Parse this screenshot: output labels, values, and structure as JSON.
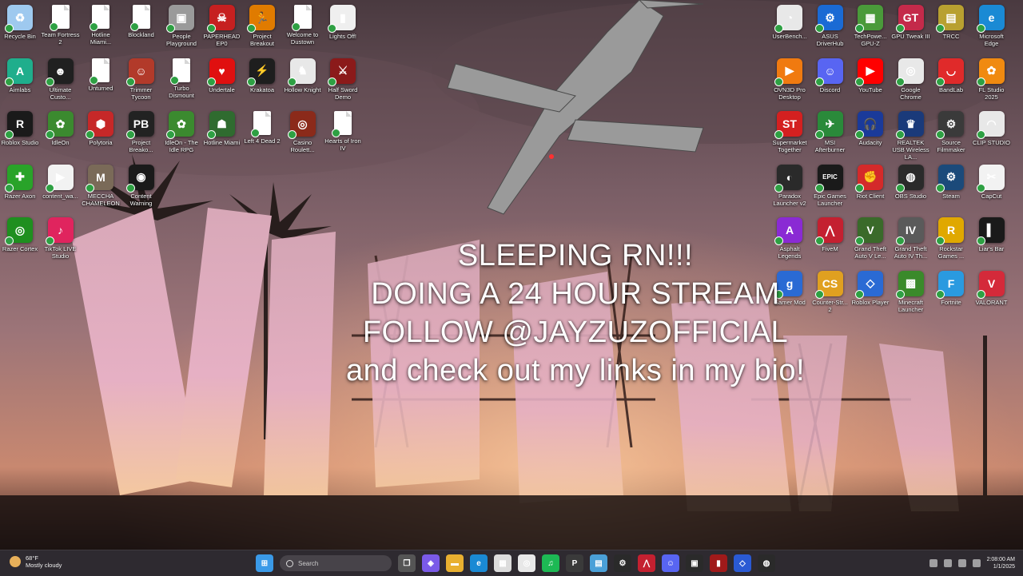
{
  "desktop": {
    "left_columns": [
      [
        {
          "label": "Recycle Bin",
          "icon": "recycle-bin-icon",
          "color": "#9ec9ef",
          "glyph": "♻"
        },
        {
          "label": "Aimlabs",
          "icon": "aimlabs-icon",
          "color": "#1fae8c",
          "glyph": "A"
        },
        {
          "label": "Roblox Studio",
          "icon": "roblox-studio-icon",
          "color": "#1a1a1a",
          "glyph": "R"
        },
        {
          "label": "Razer Axon",
          "icon": "razer-axon-icon",
          "color": "#29a329",
          "glyph": "✚"
        },
        {
          "label": "Razer Cortex",
          "icon": "razer-cortex-icon",
          "color": "#1f8f1f",
          "glyph": "◎"
        }
      ],
      [
        {
          "label": "Team Fortress 2",
          "icon": "document-icon",
          "doc": true
        },
        {
          "label": "Ultimate Custo...",
          "icon": "ultimate-custom-night-icon",
          "color": "#202020",
          "glyph": "☻"
        },
        {
          "label": "IdleOn",
          "icon": "idleon-icon",
          "color": "#3b8a2f",
          "glyph": "✿"
        },
        {
          "label": "content_wa...",
          "icon": "video-file-icon",
          "color": "#f2f2f2",
          "glyph": "▶"
        },
        {
          "label": "TikTok LIVE Studio",
          "icon": "tiktok-live-icon",
          "color": "#e0245e",
          "glyph": "♪"
        }
      ],
      [
        {
          "label": "Hotline Miami...",
          "icon": "document-icon",
          "doc": true
        },
        {
          "label": "Unturned",
          "icon": "document-icon",
          "doc": true
        },
        {
          "label": "Polytoria",
          "icon": "polytoria-icon",
          "color": "#c62828",
          "glyph": "⬢"
        },
        {
          "label": "MECCHA CHAMELEON",
          "icon": "meccha-chameleon-icon",
          "color": "#7a6a58",
          "glyph": "M"
        }
      ],
      [
        {
          "label": "Blockland",
          "icon": "document-icon",
          "doc": true
        },
        {
          "label": "Trimmer Tycoon",
          "icon": "trimmer-tycoon-icon",
          "color": "#b23a2a",
          "glyph": "☺"
        },
        {
          "label": "Project Breako...",
          "icon": "project-breakout-pb-icon",
          "color": "#222",
          "glyph": "PB"
        },
        {
          "label": "Content Warning",
          "icon": "content-warning-icon",
          "color": "#1a1a1a",
          "glyph": "◉"
        }
      ],
      [
        {
          "label": "People Playground",
          "icon": "people-playground-icon",
          "color": "#9a9a9a",
          "glyph": "▣"
        },
        {
          "label": "Turbo Dismount",
          "icon": "document-icon",
          "doc": true
        },
        {
          "label": "IdleOn - The Idle RPG",
          "icon": "idleon-rpg-icon",
          "color": "#3b8a2f",
          "glyph": "✿"
        }
      ],
      [
        {
          "label": "PAPERHEAD EP0",
          "icon": "paperhead-icon",
          "color": "#c62020",
          "glyph": "☠"
        },
        {
          "label": "Undertale",
          "icon": "undertale-icon",
          "color": "#e01010",
          "glyph": "♥"
        },
        {
          "label": "Hotline Miami",
          "icon": "hotline-miami-icon",
          "color": "#2f6b2f",
          "glyph": "☗"
        }
      ],
      [
        {
          "label": "Project Breakout",
          "icon": "project-breakout-icon",
          "color": "#e07b00",
          "glyph": "🏃"
        },
        {
          "label": "Krakatoa",
          "icon": "krakatoa-icon",
          "color": "#1e1e1e",
          "glyph": "⚡"
        },
        {
          "label": "Left 4 Dead 2",
          "icon": "document-icon",
          "doc": true
        }
      ],
      [
        {
          "label": "Welcome to Dustown",
          "icon": "document-icon",
          "doc": true
        },
        {
          "label": "Hollow Knight",
          "icon": "hollow-knight-icon",
          "color": "#e8e8e8",
          "glyph": "♞"
        },
        {
          "label": "Casino Roulett...",
          "icon": "casino-roulette-icon",
          "color": "#8b2a1a",
          "glyph": "◎"
        }
      ],
      [
        {
          "label": "Lights Off!",
          "icon": "lights-off-icon",
          "color": "#efefef",
          "glyph": "▮"
        },
        {
          "label": "Half Sword Demo",
          "icon": "half-sword-icon",
          "color": "#8b1a1a",
          "glyph": "⚔"
        },
        {
          "label": "Hearts of Iron IV",
          "icon": "document-icon",
          "doc": true
        }
      ]
    ],
    "right_columns": [
      [
        {
          "label": "UserBench...",
          "icon": "userbenchmark-icon",
          "color": "#e8e8e8",
          "glyph": "◔"
        },
        {
          "label": "OVN3D Pro Desktop",
          "icon": "ovn3d-icon",
          "color": "#f07a10",
          "glyph": "▶"
        },
        {
          "label": "Supermarket Together",
          "icon": "supermarket-together-icon",
          "color": "#d42020",
          "glyph": "ST"
        },
        {
          "label": "Paradox Launcher v2",
          "icon": "paradox-launcher-icon",
          "color": "#2a2a2a",
          "glyph": "◐"
        },
        {
          "label": "Asphalt Legends",
          "icon": "asphalt-legends-icon",
          "color": "#8a2ad4",
          "glyph": "A"
        },
        {
          "label": "Gamer Mod",
          "icon": "gamer-mod-icon",
          "color": "#2a6ad4",
          "glyph": "g"
        }
      ],
      [
        {
          "label": "ASUS DriverHub",
          "icon": "asus-driverhub-icon",
          "color": "#1a6ad4",
          "glyph": "⚙"
        },
        {
          "label": "Discord",
          "icon": "discord-icon",
          "color": "#5865f2",
          "glyph": "☺"
        },
        {
          "label": "MSI Afterburner",
          "icon": "msi-afterburner-icon",
          "color": "#2a8a3a",
          "glyph": "✈"
        },
        {
          "label": "Epic Games Launcher",
          "icon": "epic-games-icon",
          "color": "#1a1a1a",
          "glyph": "EPIC"
        },
        {
          "label": "FiveM",
          "icon": "fivem-icon",
          "color": "#c42030",
          "glyph": "⋀"
        },
        {
          "label": "Counter-Str... 2",
          "icon": "counter-strike-icon",
          "color": "#e0a020",
          "glyph": "CS"
        }
      ],
      [
        {
          "label": "TechPowe... GPU-Z",
          "icon": "gpu-z-icon",
          "color": "#4a9a3a",
          "glyph": "▦"
        },
        {
          "label": "YouTube",
          "icon": "youtube-icon",
          "color": "#ff0000",
          "glyph": "▶"
        },
        {
          "label": "Audacity",
          "icon": "audacity-icon",
          "color": "#1a3a9a",
          "glyph": "🎧"
        },
        {
          "label": "Riot Client",
          "icon": "riot-client-icon",
          "color": "#d42a2a",
          "glyph": "✊"
        },
        {
          "label": "Grand Theft Auto V Le...",
          "icon": "gta-v-icon",
          "color": "#3a6a2a",
          "glyph": "V"
        },
        {
          "label": "Roblox Player",
          "icon": "roblox-player-icon",
          "color": "#2a6ad4",
          "glyph": "◇"
        }
      ],
      [
        {
          "label": "GPU Tweak III",
          "icon": "gpu-tweak-icon",
          "color": "#c42a4a",
          "glyph": "GT"
        },
        {
          "label": "Google Chrome",
          "icon": "google-chrome-icon",
          "color": "#e8e8e8",
          "glyph": "◎"
        },
        {
          "label": "REALTEK USB Wireless LA...",
          "icon": "realtek-icon",
          "color": "#1a3a7a",
          "glyph": "♛"
        },
        {
          "label": "OBS Studio",
          "icon": "obs-studio-icon",
          "color": "#2a2a2a",
          "glyph": "◍"
        },
        {
          "label": "Grand Theft Auto IV Th...",
          "icon": "gta-iv-icon",
          "color": "#5a5a5a",
          "glyph": "IV"
        },
        {
          "label": "Minecraft Launcher",
          "icon": "minecraft-launcher-icon",
          "color": "#3a8a2a",
          "glyph": "▩"
        }
      ],
      [
        {
          "label": "TRCC",
          "icon": "trcc-icon",
          "color": "#b8a030",
          "glyph": "▤"
        },
        {
          "label": "BandLab",
          "icon": "bandlab-icon",
          "color": "#e02a2a",
          "glyph": "◡"
        },
        {
          "label": "Source Filmmaker",
          "icon": "source-filmmaker-icon",
          "color": "#3a3a3a",
          "glyph": "⚙"
        },
        {
          "label": "Steam",
          "icon": "steam-icon",
          "color": "#1b4a7a",
          "glyph": "⚙"
        },
        {
          "label": "Rockstar Games ...",
          "icon": "rockstar-games-icon",
          "color": "#e0a800",
          "glyph": "R"
        },
        {
          "label": "Fortnite",
          "icon": "fortnite-icon",
          "color": "#2a9ae0",
          "glyph": "F"
        }
      ],
      [
        {
          "label": "Microsoft Edge",
          "icon": "microsoft-edge-icon",
          "color": "#1a8ad4",
          "glyph": "e"
        },
        {
          "label": "FL Studio 2025",
          "icon": "fl-studio-icon",
          "color": "#f08a10",
          "glyph": "✿"
        },
        {
          "label": "CLIP STUDIO",
          "icon": "clip-studio-icon",
          "color": "#e8e8e8",
          "glyph": "◠"
        },
        {
          "label": "CapCut",
          "icon": "capcut-icon",
          "color": "#f2f2f2",
          "glyph": "✂"
        },
        {
          "label": "Liar's Bar",
          "icon": "liars-bar-icon",
          "color": "#1a1a1a",
          "glyph": "▍"
        },
        {
          "label": "VALORANT",
          "icon": "valorant-icon",
          "color": "#d42a3a",
          "glyph": "V"
        }
      ]
    ]
  },
  "overlay": {
    "line1": "SLEEPING RN!!!",
    "line2": "DOING A 24 HOUR STREAM",
    "line3": "FOLLOW @JAYZUZOFFICIAL",
    "line4": "and check out my links in my bio!"
  },
  "taskbar": {
    "weather_temp": "68°F",
    "weather_desc": "Mostly cloudy",
    "search_placeholder": "Search",
    "apps": [
      {
        "name": "start-button",
        "color": "#3a9ae8",
        "glyph": "⊞"
      },
      {
        "name": "task-view-icon",
        "color": "#555",
        "glyph": "❐"
      },
      {
        "name": "copilot-icon",
        "color": "#7a5ae8",
        "glyph": "◈"
      },
      {
        "name": "file-explorer-icon",
        "color": "#e8b030",
        "glyph": "▬"
      },
      {
        "name": "edge-taskbar-icon",
        "color": "#1a8ad4",
        "glyph": "e"
      },
      {
        "name": "store-icon",
        "color": "#dcdcdc",
        "glyph": "▦"
      },
      {
        "name": "chrome-taskbar-icon",
        "color": "#e8e8e8",
        "glyph": "◎"
      },
      {
        "name": "spotify-icon",
        "color": "#1db954",
        "glyph": "♫"
      },
      {
        "name": "app-p-icon",
        "color": "#3a3a3a",
        "glyph": "P"
      },
      {
        "name": "notepad-icon",
        "color": "#4aa0d8",
        "glyph": "▤"
      },
      {
        "name": "steam-taskbar-icon",
        "color": "#2a2a2a",
        "glyph": "⚙"
      },
      {
        "name": "fivem-taskbar-icon",
        "color": "#c42030",
        "glyph": "⋀"
      },
      {
        "name": "discord-taskbar-icon",
        "color": "#5865f2",
        "glyph": "☺"
      },
      {
        "name": "roblox-studio-taskbar-icon",
        "color": "#2a2a2a",
        "glyph": "▣"
      },
      {
        "name": "app-red-icon",
        "color": "#a01a1a",
        "glyph": "▮"
      },
      {
        "name": "roblox-taskbar-icon",
        "color": "#2a5ad4",
        "glyph": "◇"
      },
      {
        "name": "obs-taskbar-icon",
        "color": "#2a2a2a",
        "glyph": "◍"
      }
    ],
    "clock_time": "2:08:00 AM",
    "clock_date": "1/1/2025"
  }
}
